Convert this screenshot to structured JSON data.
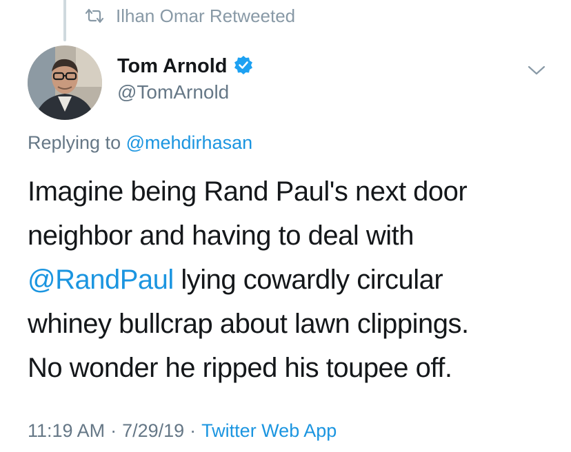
{
  "retweet": {
    "icon": "retweet-icon",
    "label": "Ilhan Omar Retweeted"
  },
  "author": {
    "name": "Tom Arnold",
    "handle": "@TomArnold",
    "verified_icon": "verified-badge-icon",
    "avatar": "avatar-photo"
  },
  "menu": {
    "icon": "chevron-down-icon"
  },
  "reply": {
    "prefix": "Replying to",
    "mention": "@mehdirhasan"
  },
  "tweet": {
    "line1": "Imagine being Rand Paul's next door",
    "line2": "neighbor and having to deal with",
    "line3_mention": "@RandPaul",
    "line3_rest": " lying cowardly circular",
    "line4": "whiney bullcrap about lawn clippings.",
    "line5": "No wonder he ripped his toupee off."
  },
  "meta": {
    "time": "11:19 AM",
    "sep1": "·",
    "date": "7/29/19",
    "sep2": "·",
    "source": "Twitter Web App"
  },
  "colors": {
    "link": "#1b95e0",
    "secondary_text": "#657786",
    "retweet_text": "#8899a6",
    "verified": "#1da1f2"
  }
}
